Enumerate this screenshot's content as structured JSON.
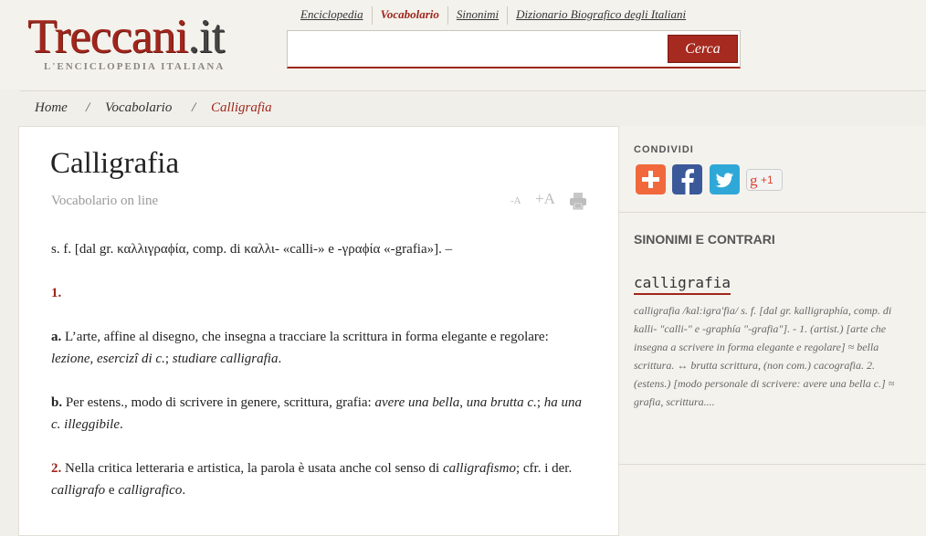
{
  "header": {
    "logo_main": "Treccani",
    "logo_suffix": ".it",
    "logo_tagline": "L'ENCICLOPEDIA ITALIANA",
    "nav": [
      {
        "label": "Enciclopedia"
      },
      {
        "label": "Vocabolario",
        "active": true
      },
      {
        "label": "Sinonimi"
      },
      {
        "label": "Dizionario Biografico degli Italiani"
      }
    ],
    "search": {
      "value": "",
      "button": "Cerca"
    }
  },
  "breadcrumb": {
    "home": "Home",
    "section": "Vocabolario",
    "current": "Calligrafia",
    "separator": "/"
  },
  "entry": {
    "title": "Calligrafia",
    "subtitle": "Vocabolario on line",
    "font_smaller": "-A",
    "font_larger": "+A",
    "etym": "s. f. [dal gr. καλλιγραϕία, comp. di καλλι- «calli-» e -γραϕία «-grafia»]. –",
    "sense1_num": "1.",
    "sense1a": {
      "label": "a.",
      "text": " L’arte, affine al disegno, che insegna a tracciare la scrittura in forma elegante e regolare: ",
      "ex1": "lezione",
      "sep1": ", ",
      "ex2": "esercizî di c.",
      "sep2": "; ",
      "ex3": "studiare calligrafia",
      "end": "."
    },
    "sense1b": {
      "label": "b.",
      "text": " Per estens., modo di scrivere in genere, scrittura, grafia: ",
      "ex1": "avere una bella",
      "sep1": ", ",
      "ex2": "una brutta c.",
      "sep2": "; ",
      "ex3": "ha una c. illeggibile",
      "end": "."
    },
    "sense2": {
      "num": "2.",
      "text": " Nella critica letteraria e artistica, la parola è usata anche col senso di ",
      "ex1": "calligrafismo",
      "mid": "; cfr. i der. ",
      "ex2": "calligrafo",
      "and": " e ",
      "ex3": "calligrafico",
      "end": "."
    }
  },
  "sidebar": {
    "share_label": "CONDIVIDI",
    "share_gplus": "+1",
    "section_title": "SINONIMI E CONTRARI",
    "word": "calligrafia",
    "definition": "calligrafia /kal:igra'fia/ s. f. [dal gr. kalligraphía, comp. di kalli- \"calli-\" e -graphía \"-grafia\"]. - 1. (artist.) [arte che insegna a scrivere in forma elegante e regolare] ≈ bella scrittura. ↔ brutta scrittura, (non com.) cacografia. 2. (estens.) [modo personale di scrivere: avere una bella c.] ≈ grafia, scrittura...."
  },
  "colors": {
    "brand": "#a1261c",
    "background": "#f0efea",
    "content_bg": "#ffffff"
  }
}
